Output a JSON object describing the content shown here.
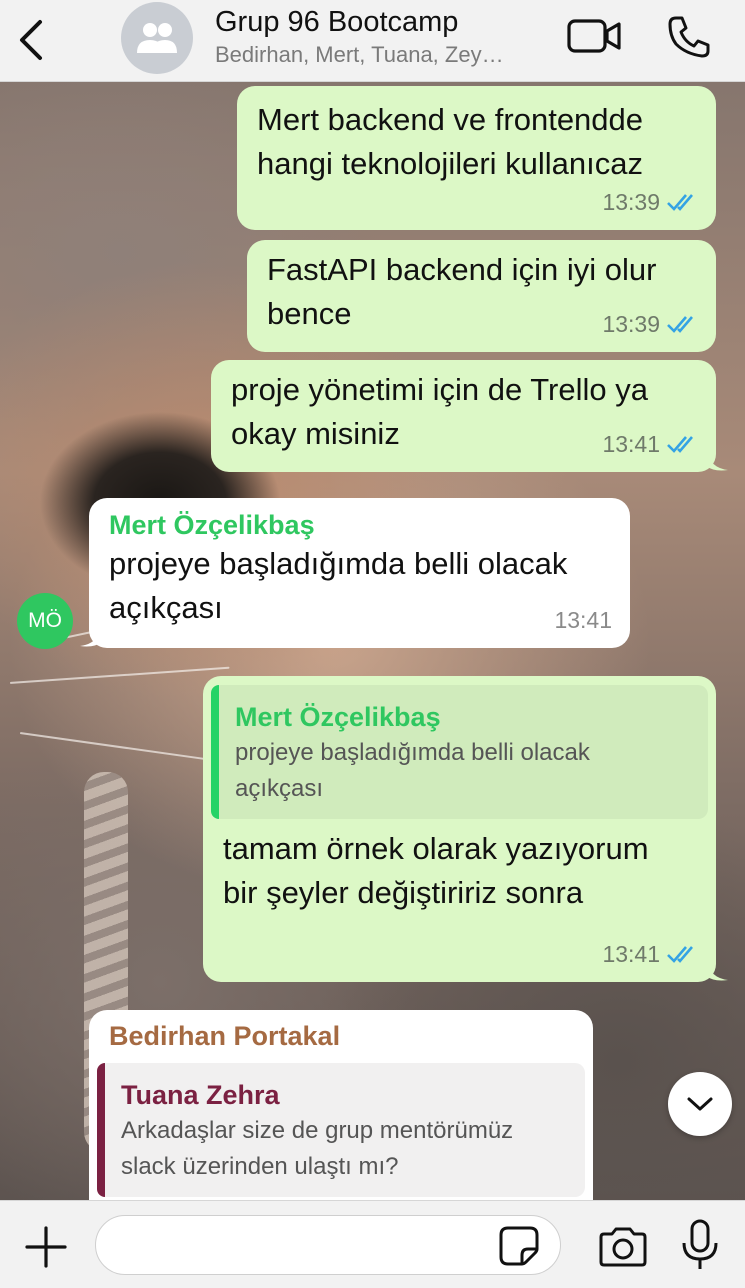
{
  "header": {
    "title": "Grup 96 Bootcamp",
    "subtitle": "Bedirhan, Mert, Tuana, Zey…",
    "icons": [
      "chevron-left-icon",
      "group-avatar-icon",
      "video-call-icon",
      "phone-call-icon"
    ]
  },
  "messages": [
    {
      "direction": "outgoing",
      "text_lines": [
        "Mert backend ve frontendde",
        "hangi teknolojileri kullanıcaz"
      ],
      "time": "13:39",
      "status": "read"
    },
    {
      "direction": "outgoing",
      "text_lines": [
        "FastAPI backend için iyi olur",
        "bence"
      ],
      "time": "13:39",
      "status": "read"
    },
    {
      "direction": "outgoing",
      "text_lines": [
        "proje yönetimi için de Trello ya",
        "okay misiniz"
      ],
      "time": "13:41",
      "status": "read"
    },
    {
      "direction": "incoming",
      "sender": "Mert Özçelikbaş",
      "sender_color": "#2fc760",
      "avatar_initials": "MÖ",
      "text_lines": [
        "projeye başladığımda belli olacak",
        "açıkçası"
      ],
      "time": "13:41"
    },
    {
      "direction": "outgoing",
      "quote": {
        "name": "Mert Özçelikbaş",
        "text_lines": [
          "projeye başladığımda belli olacak",
          "açıkçası"
        ]
      },
      "text_lines": [
        "tamam örnek olarak yazıyorum",
        "bir şeyler değiştiririz sonra"
      ],
      "time": "13:41",
      "status": "read"
    },
    {
      "direction": "incoming",
      "sender": "Bedirhan Portakal",
      "sender_color": "#a56a42",
      "quote": {
        "name": "Tuana Zehra",
        "name_color": "#7b2142",
        "text_lines": [
          "Arkadaşlar size de grup mentörümüz",
          "slack üzerinden ulaştı mı?"
        ]
      }
    }
  ],
  "composer": {
    "placeholder": "",
    "icons": [
      "plus-icon",
      "sticker-icon",
      "camera-icon",
      "microphone-icon"
    ]
  },
  "colors": {
    "outgoing_bubble": "#dcf8c6",
    "incoming_bubble": "#ffffff",
    "read_ticks": "#34a3e4"
  }
}
